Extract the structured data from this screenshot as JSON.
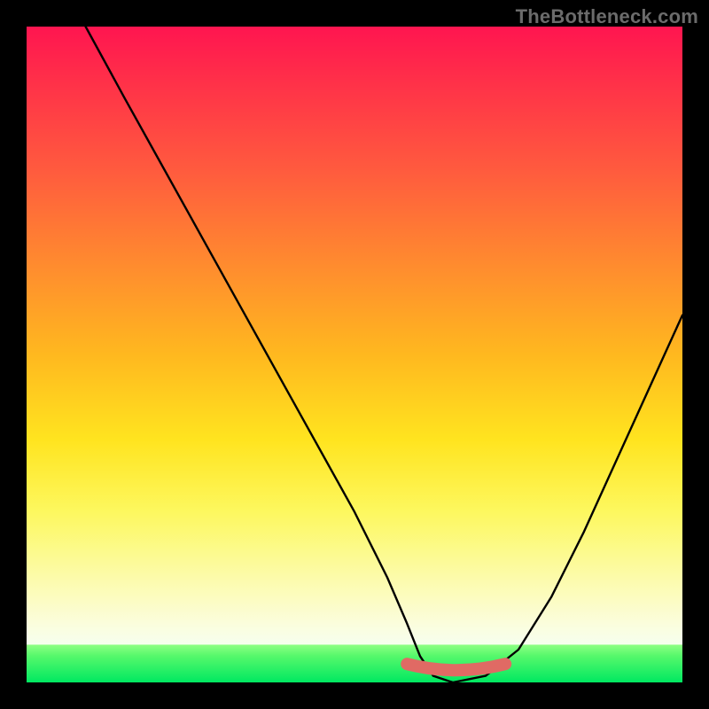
{
  "watermark": {
    "text": "TheBottleneck.com"
  },
  "colors": {
    "background_black": "#000000",
    "gradient_top": "#ff1550",
    "gradient_mid": "#ffe41f",
    "gradient_bottom_green": "#00e861",
    "curve_stroke": "#000000",
    "trough_bar": "#e06a64"
  },
  "chart_data": {
    "type": "line",
    "title": "",
    "xlabel": "",
    "ylabel": "",
    "xlim": [
      0,
      100
    ],
    "ylim": [
      0,
      100
    ],
    "series": [
      {
        "name": "bottleneck-curve",
        "x": [
          9,
          15,
          20,
          25,
          30,
          35,
          40,
          45,
          50,
          55,
          58,
          60,
          62,
          65,
          70,
          75,
          80,
          85,
          90,
          95,
          100
        ],
        "values": [
          100,
          89,
          80,
          71,
          62,
          53,
          44,
          35,
          26,
          16,
          9,
          4,
          1,
          0,
          1,
          5,
          13,
          23,
          34,
          45,
          56
        ]
      }
    ],
    "annotations": [
      {
        "name": "trough-bar",
        "x_start": 58,
        "x_end": 73,
        "y": 2
      }
    ]
  }
}
